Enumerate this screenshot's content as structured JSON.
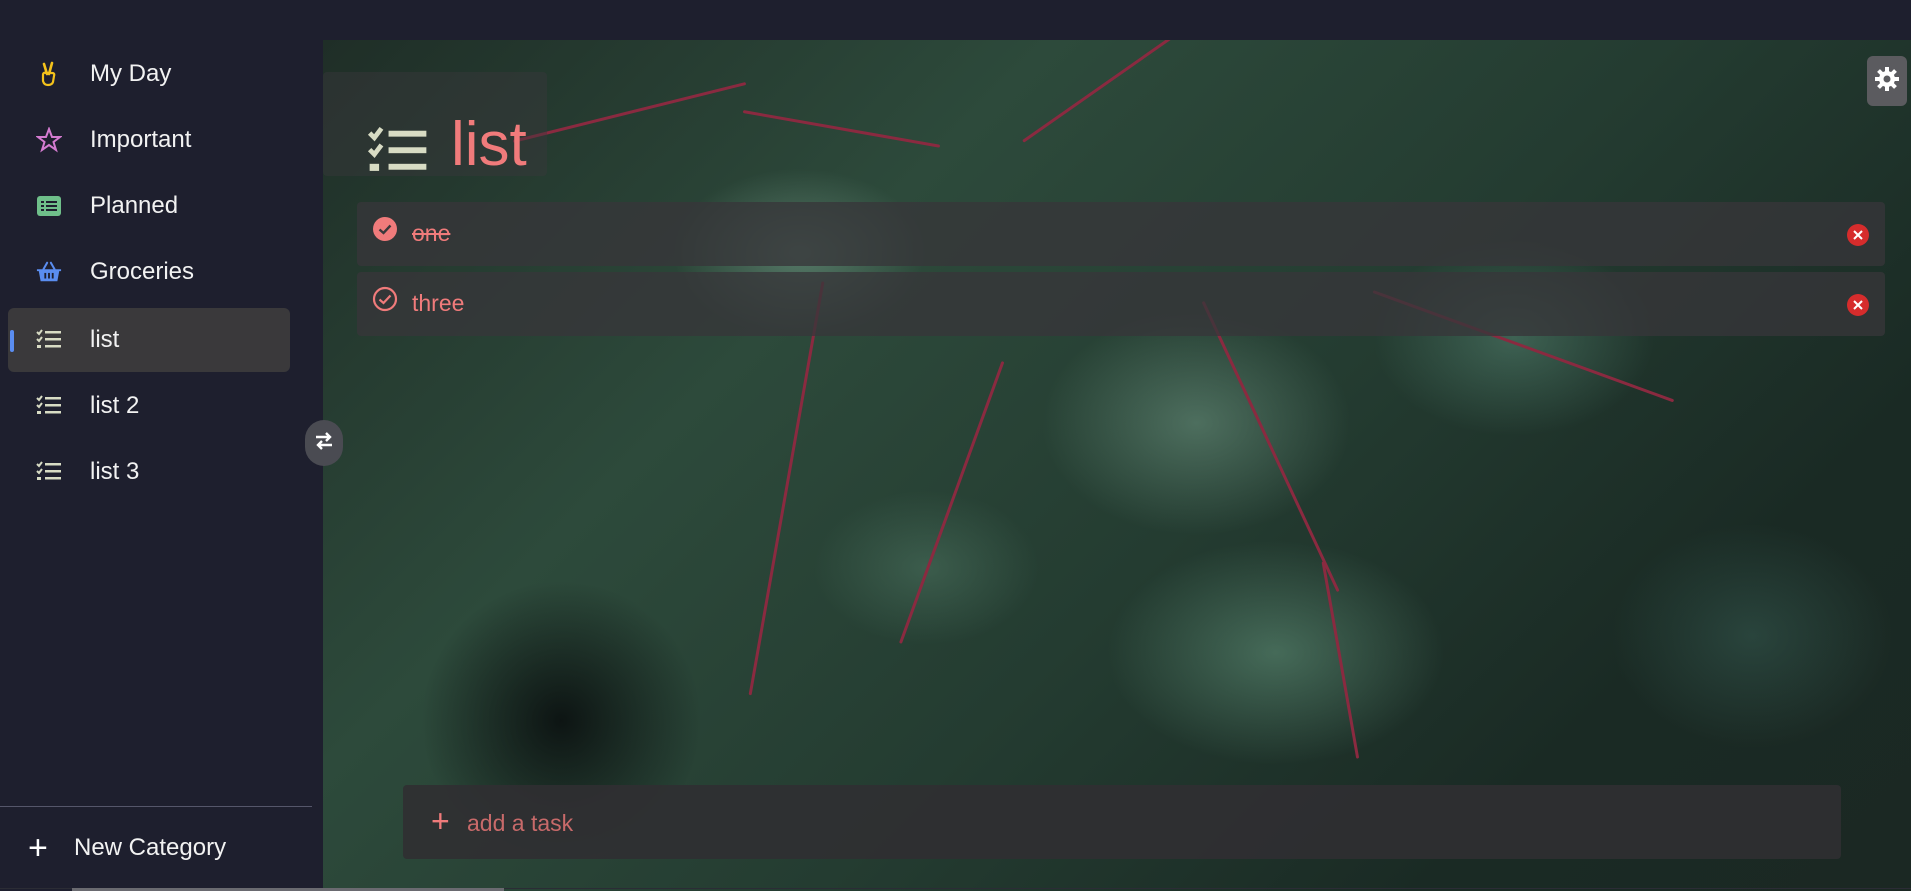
{
  "sidebar": {
    "items": [
      {
        "label": "My Day",
        "icon": "peace-hand-icon",
        "color": "#f4c21b"
      },
      {
        "label": "Important",
        "icon": "star-icon",
        "color": "#d47bd0"
      },
      {
        "label": "Planned",
        "icon": "list-card-icon",
        "color": "#6fbf8a"
      },
      {
        "label": "Groceries",
        "icon": "basket-icon",
        "color": "#5a8df0"
      },
      {
        "label": "list",
        "icon": "checklist-icon",
        "color": "#d8dcc4",
        "active": true
      },
      {
        "label": "list 2",
        "icon": "checklist-icon",
        "color": "#d8dcc4"
      },
      {
        "label": "list 3",
        "icon": "checklist-icon",
        "color": "#d8dcc4"
      }
    ],
    "new_category_label": "New Category"
  },
  "main": {
    "title": "list",
    "accent_color": "#f07b7b",
    "tasks": [
      {
        "text": "one",
        "completed": true
      },
      {
        "text": "three",
        "completed": false
      }
    ],
    "add_task_placeholder": "add a task"
  }
}
